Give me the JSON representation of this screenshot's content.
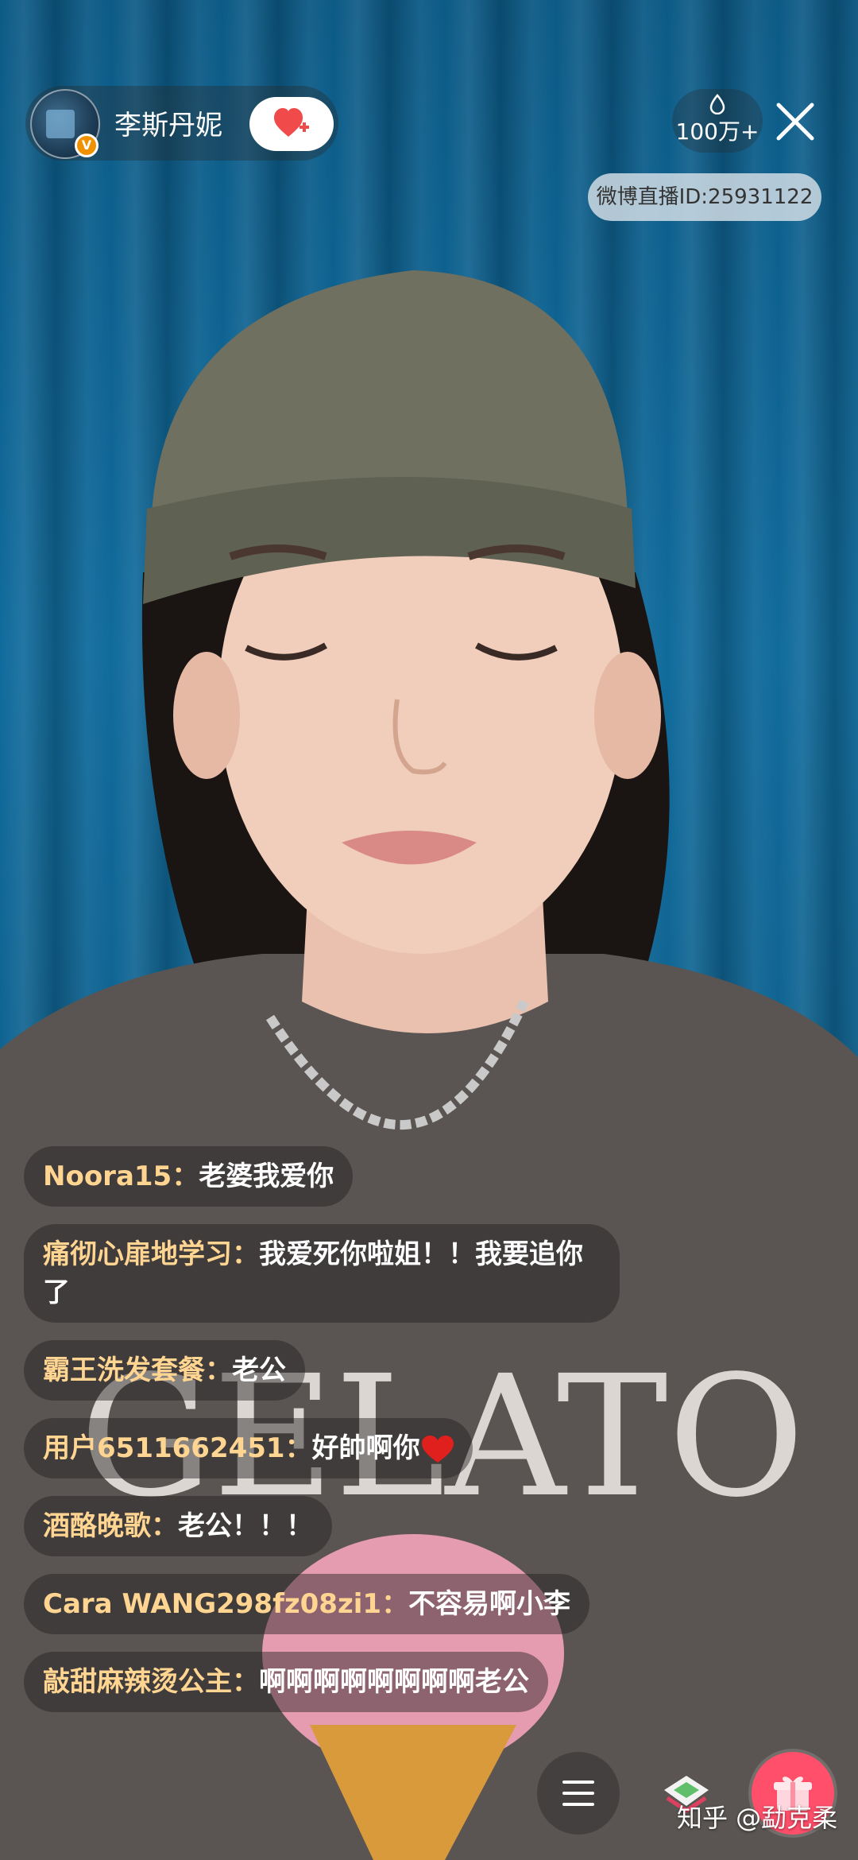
{
  "host": {
    "name": "李斯丹妮",
    "verified_badge": "V",
    "avatar_icon": "avatar-image"
  },
  "header": {
    "viewer_count": "100万+",
    "room_id": "微博直播ID:25931122"
  },
  "comments": [
    {
      "user": "Noora15：",
      "text": "老婆我爱你",
      "heart": false
    },
    {
      "user": "痛彻心扉地学习：",
      "text": "我爱死你啦姐！！我要追你了",
      "heart": false
    },
    {
      "user": "霸王洗发套餐：",
      "text": "老公",
      "heart": false
    },
    {
      "user": "用户6511662451：",
      "text": "好帥啊你",
      "heart": true
    },
    {
      "user": "酒酪晚歌：",
      "text": "老公！！！",
      "heart": false
    },
    {
      "user": "Cara WANG298fz08zi1：",
      "text": "不容易啊小李",
      "heart": false
    },
    {
      "user": "敲甜麻辣烫公主：",
      "text": "啊啊啊啊啊啊啊啊老公",
      "heart": false
    }
  ],
  "watermark": "知乎 @勐克柔",
  "colors": {
    "username": "#ffd591",
    "follow_heart": "#f04a4a",
    "gift_button": "#ff4f6a",
    "badge": "#f29100"
  },
  "icons": {
    "follow": "heart-plus-icon",
    "viewers": "drop-icon",
    "close": "close-icon",
    "menu": "menu-icon",
    "gift": "gift-icon",
    "item": "ticket-icon",
    "comment_heart": "heart-icon"
  }
}
